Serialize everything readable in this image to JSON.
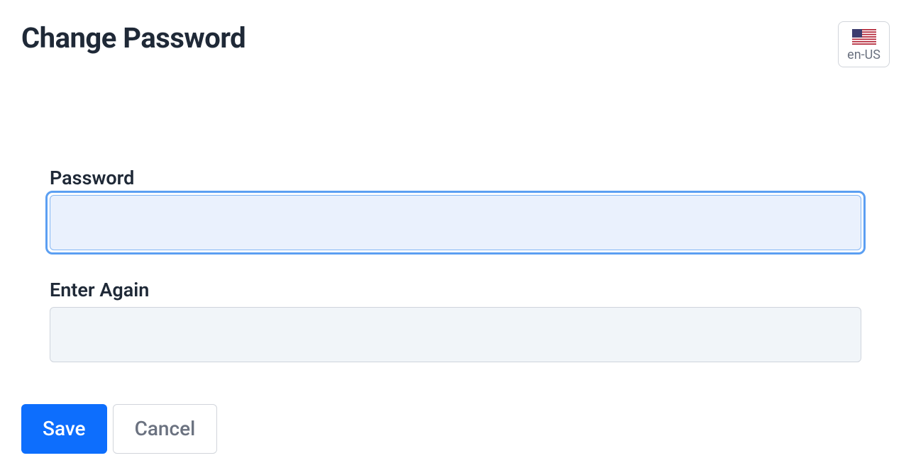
{
  "header": {
    "title": "Change Password"
  },
  "locale": {
    "code": "en-US"
  },
  "form": {
    "password": {
      "label": "Password",
      "value": ""
    },
    "confirm": {
      "label": "Enter Again",
      "value": ""
    }
  },
  "buttons": {
    "save": "Save",
    "cancel": "Cancel"
  }
}
